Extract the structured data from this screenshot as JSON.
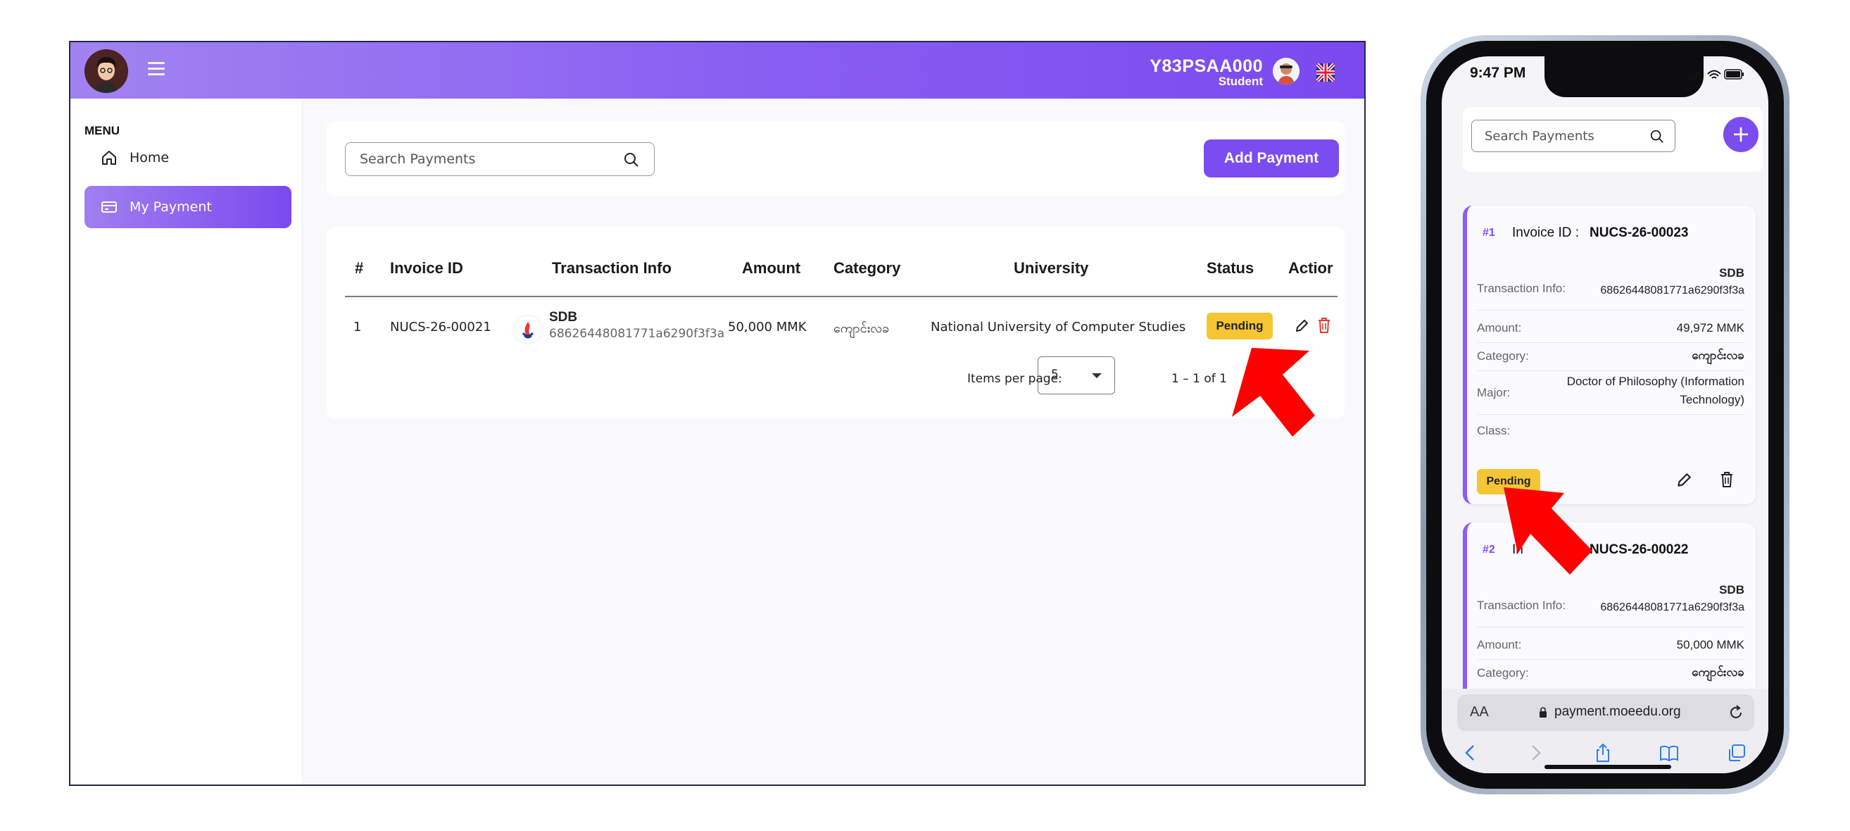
{
  "desktop": {
    "header": {
      "user_id": "Y83PSAA000",
      "role": "Student"
    },
    "sidebar": {
      "menu_title": "MENU",
      "items": [
        {
          "label": "Home",
          "icon": "home-icon"
        },
        {
          "label": "My Payment",
          "icon": "card-icon",
          "active": true
        }
      ]
    },
    "search": {
      "placeholder": "Search Payments"
    },
    "add_button": "Add Payment",
    "table": {
      "columns": [
        "#",
        "Invoice ID",
        "Transaction Info",
        "Amount",
        "Category",
        "University",
        "Status",
        "Actior"
      ],
      "rows": [
        {
          "index": "1",
          "invoice_id": "NUCS-26-00021",
          "bank": "SDB",
          "txn": "68626448081771a6290f3f3a",
          "amount": "50,000 MMK",
          "category": "ကျောင်းလခ",
          "university": "National University of Computer Studies",
          "status": "Pending"
        }
      ],
      "pagination": {
        "items_per_page_label": "Items per page:",
        "items_per_page": "5",
        "range": "1 – 1 of 1"
      }
    }
  },
  "phone": {
    "status_time": "9:47 PM",
    "search_placeholder": "Search Payments",
    "add_symbol": "+",
    "cards": [
      {
        "index": "#1",
        "invoice_label": "Invoice ID :",
        "invoice_id": "NUCS-26-00023",
        "txn_label": "Transaction Info:",
        "bank": "SDB",
        "txn": "68626448081771a6290f3f3a",
        "amount_label": "Amount:",
        "amount": "49,972 MMK",
        "category_label": "Category:",
        "category": "ကျောင်းလခ",
        "major_label": "Major:",
        "major_line1": "Doctor of Philosophy (Information",
        "major_line2": "Technology)",
        "class_label": "Class:",
        "status": "Pending"
      },
      {
        "index": "#2",
        "invoice_label": "In",
        "invoice_id": "NUCS-26-00022",
        "txn_label": "Transaction Info:",
        "bank": "SDB",
        "txn": "68626448081771a6290f3f3a",
        "amount_label": "Amount:",
        "amount": "50,000 MMK",
        "category_label": "Category:",
        "category": "ကျောင်းလခ"
      }
    ],
    "browser": {
      "aa_label": "AA",
      "url": "payment.moeedu.org"
    }
  },
  "colors": {
    "brand_purple": "#7b4cf0",
    "pending_badge": "#f6c533",
    "delete_red": "#e53935",
    "annotation_arrow": "#ff0000"
  }
}
